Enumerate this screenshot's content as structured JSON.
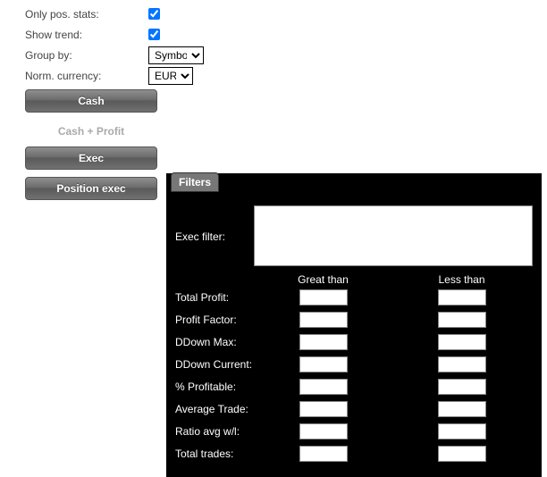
{
  "settings": {
    "only_pos_stats": {
      "label": "Only pos. stats:",
      "checked": true
    },
    "show_trend": {
      "label": "Show trend:",
      "checked": true
    },
    "group_by": {
      "label": "Group by:",
      "value": "Symbol"
    },
    "norm_currency": {
      "label": "Norm. currency:",
      "value": "EUR"
    }
  },
  "buttons": {
    "cash": "Cash",
    "cash_profit": "Cash + Profit",
    "exec": "Exec",
    "position_exec": "Position exec"
  },
  "filters": {
    "tab": "Filters",
    "exec_filter_label": "Exec filter:",
    "exec_filter_value": "",
    "col_gt": "Great than",
    "col_lt": "Less than",
    "rows": [
      {
        "label": "Total Profit:",
        "gt": "",
        "lt": ""
      },
      {
        "label": "Profit Factor:",
        "gt": "",
        "lt": ""
      },
      {
        "label": "DDown Max:",
        "gt": "",
        "lt": ""
      },
      {
        "label": "DDown Current:",
        "gt": "",
        "lt": ""
      },
      {
        "label": "% Profitable:",
        "gt": "",
        "lt": ""
      },
      {
        "label": "Average Trade:",
        "gt": "",
        "lt": ""
      },
      {
        "label": "Ratio avg w/l:",
        "gt": "",
        "lt": ""
      },
      {
        "label": "Total trades:",
        "gt": "",
        "lt": ""
      }
    ]
  }
}
